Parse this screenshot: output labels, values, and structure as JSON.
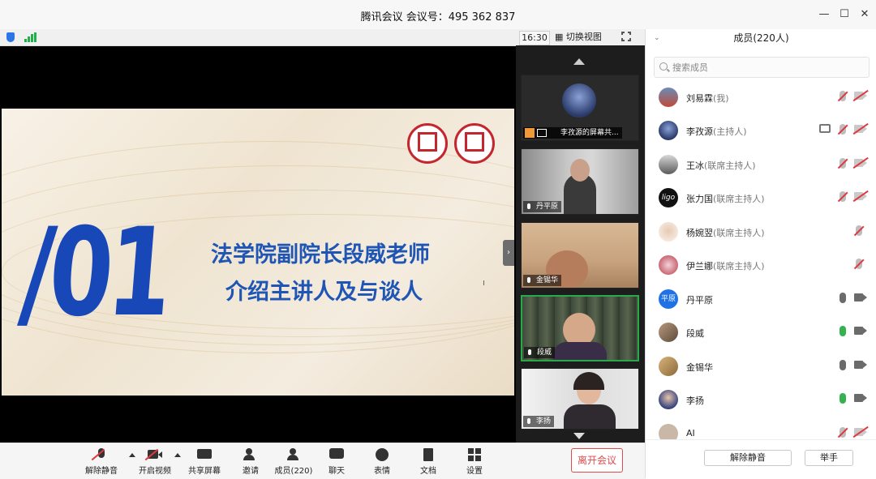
{
  "window": {
    "title": "腾讯会议 会议号：495 362 837"
  },
  "stage": {
    "clock": "16:30",
    "switch_view_label": "切换视图",
    "slide": {
      "number": "/01",
      "line1": "法学院副院长段威老师",
      "line2": "介绍主讲人及与谈人"
    },
    "thumbnails": [
      {
        "label": "李孜源的屏幕共..."
      },
      {
        "label": "丹平原"
      },
      {
        "label": "金锡华"
      },
      {
        "label": "段威"
      },
      {
        "label": "李扬"
      }
    ]
  },
  "toolbar": {
    "unmute_label": "解除静音",
    "video_label": "开启视频",
    "share_label": "共享屏幕",
    "invite_label": "邀请",
    "members_label": "成员(220)",
    "chat_label": "聊天",
    "reaction_label": "表情",
    "docs_label": "文档",
    "settings_label": "设置",
    "leave_label": "离开会议"
  },
  "panel": {
    "title": "成员(220人)",
    "search_placeholder": "搜索成员",
    "members": [
      {
        "name": "刘易霖",
        "role": "(我)"
      },
      {
        "name": "李孜源",
        "role": "(主持人)"
      },
      {
        "name": "王冰",
        "role": "(联席主持人)"
      },
      {
        "name": "张力国",
        "role": "(联席主持人)",
        "avatar_text": "ligo"
      },
      {
        "name": "杨婉翌",
        "role": "(联席主持人)"
      },
      {
        "name": "伊兰娜",
        "role": "(联席主持人)"
      },
      {
        "name": "丹平原",
        "role": "",
        "avatar_text": "平原"
      },
      {
        "name": "段威",
        "role": ""
      },
      {
        "name": "金锡华",
        "role": ""
      },
      {
        "name": "李扬",
        "role": ""
      },
      {
        "name": "AI",
        "role": ""
      }
    ],
    "unmute_all_label": "解除静音",
    "raise_hand_label": "举手"
  }
}
